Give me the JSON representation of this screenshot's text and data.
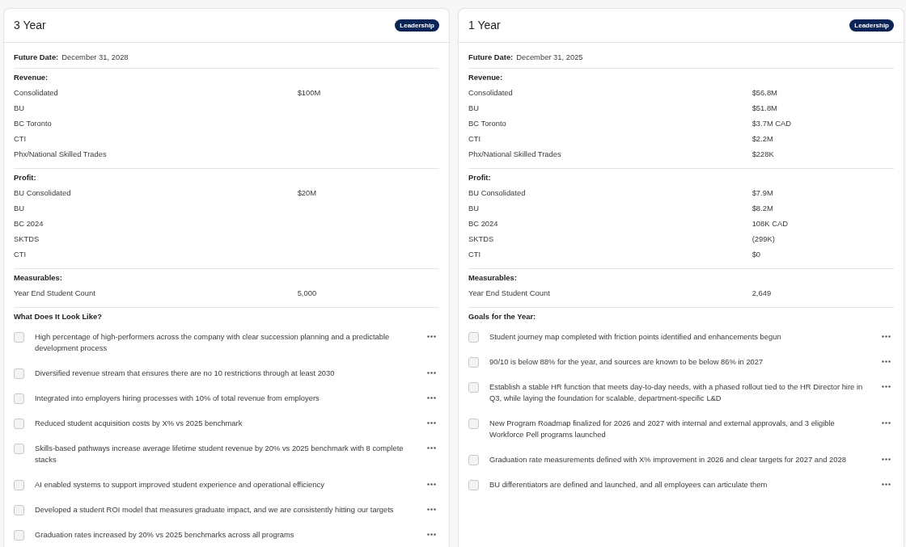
{
  "cards": [
    {
      "title": "3 Year",
      "badge": "Leadership",
      "future_date": {
        "label": "Future Date:",
        "value": "December 31, 2028"
      },
      "sections": [
        {
          "heading": "Revenue:",
          "rows": [
            {
              "label": "Consolidated",
              "value": "$100M"
            },
            {
              "label": "BU"
            },
            {
              "label": "BC Toronto"
            },
            {
              "label": "CTI"
            },
            {
              "label": "Phx/National Skilled Trades"
            }
          ]
        },
        {
          "heading": "Profit:",
          "rows": [
            {
              "label": "BU Consolidated",
              "value": "$20M"
            },
            {
              "label": "BU"
            },
            {
              "label": "BC 2024"
            },
            {
              "label": "SKTDS"
            },
            {
              "label": "CTI"
            }
          ]
        },
        {
          "heading": "Measurables:",
          "rows": [
            {
              "label": "Year End Student Count",
              "value": "5,000"
            }
          ]
        }
      ],
      "checklist": {
        "heading": "What Does It Look Like?",
        "items": [
          {
            "text": "High percentage of high-performers across the company with clear succession planning and a predictable development process",
            "checked": false
          },
          {
            "text": "Diversified revenue stream that ensures there are no 10 restrictions through at least 2030",
            "checked": false
          },
          {
            "text": "Integrated into employers hiring processes with 10% of total revenue from employers",
            "checked": false
          },
          {
            "text": "Reduced student acquisition costs by X% vs 2025 benchmark",
            "checked": false
          },
          {
            "text": "Skills-based pathways increase average lifetime student revenue by 20% vs 2025 benchmark with 8 complete stacks",
            "checked": false
          },
          {
            "text": "AI enabled systems to support improved student experience and operational efficiency",
            "checked": false
          },
          {
            "text": "Developed a student ROI model that measures graduate impact, and we are consistently hitting our targets",
            "checked": false
          },
          {
            "text": "Graduation rates increased by 20% vs 2025 benchmarks across all programs",
            "checked": false
          }
        ]
      }
    },
    {
      "title": "1 Year",
      "badge": "Leadership",
      "future_date": {
        "label": "Future Date:",
        "value": "December 31, 2025"
      },
      "sections": [
        {
          "heading": "Revenue:",
          "rows": [
            {
              "label": "Consolidated",
              "value": "$56.8M"
            },
            {
              "label": "BU",
              "value": "$51.8M"
            },
            {
              "label": "BC Toronto",
              "value": "$3.7M CAD"
            },
            {
              "label": "CTI",
              "value": "$2.2M"
            },
            {
              "label": "Phx/National Skilled Trades",
              "value": "$228K"
            }
          ]
        },
        {
          "heading": "Profit:",
          "rows": [
            {
              "label": "BU Consolidated",
              "value": "$7.9M"
            },
            {
              "label": "BU",
              "value": "$8.2M"
            },
            {
              "label": "BC 2024",
              "value": "108K CAD"
            },
            {
              "label": "SKTDS",
              "value": "(299K)"
            },
            {
              "label": "CTI",
              "value": "$0"
            }
          ]
        },
        {
          "heading": "Measurables:",
          "rows": [
            {
              "label": "Year End Student Count",
              "value": "2,649"
            }
          ]
        }
      ],
      "checklist": {
        "heading": "Goals for the Year:",
        "items": [
          {
            "text": "Student journey map completed with friction points identified and enhancements begun",
            "checked": false
          },
          {
            "text": "90/10 is below 88% for the year, and sources are known to be below 86% in 2027",
            "checked": false
          },
          {
            "text": "Establish a stable HR function that meets day-to-day needs, with a phased rollout tied to the HR Director hire in Q3, while laying the foundation for scalable, department-specific L&D",
            "checked": false
          },
          {
            "text": "New Program Roadmap finalized for 2026 and 2027 with internal and external approvals, and 3 eligible Workforce Pell programs launched",
            "checked": false
          },
          {
            "text": "Graduation rate measurements defined with X% improvement in 2026 and clear targets for 2027 and 2028",
            "checked": false
          },
          {
            "text": "BU differentiators are defined and launched, and all employees can articulate them",
            "checked": false
          }
        ]
      }
    }
  ]
}
